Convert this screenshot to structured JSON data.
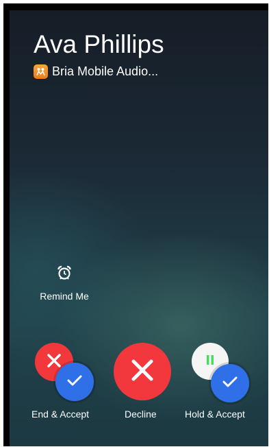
{
  "caller": {
    "name": "Ava Phillips"
  },
  "app": {
    "name": "Bria Mobile Audio...",
    "icon": "bria-app-icon",
    "icon_color": "#f59a2e"
  },
  "remind": {
    "label": "Remind Me",
    "icon": "alarm-clock-icon"
  },
  "actions": {
    "end_accept": {
      "label": "End & Accept",
      "icons": [
        "x-icon",
        "check-icon"
      ]
    },
    "decline": {
      "label": "Decline",
      "icon": "x-icon"
    },
    "hold_accept": {
      "label": "Hold & Accept",
      "icons": [
        "pause-icon",
        "check-icon"
      ]
    }
  },
  "colors": {
    "decline_red": "#f2383d",
    "accept_blue": "#2f6fe8",
    "pause_green": "#4cd964"
  }
}
